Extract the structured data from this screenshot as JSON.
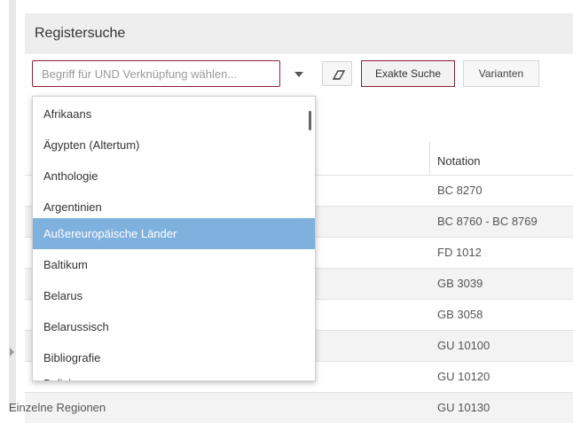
{
  "header": {
    "title": "Registersuche"
  },
  "toolbar": {
    "search_placeholder": "Begriff für UND Verknüpfung wählen...",
    "exact_button": "Exakte Suche",
    "variants_button": "Varianten"
  },
  "table": {
    "notation_header": "Notation",
    "rows": [
      {
        "label": "",
        "notation": "BC 8270"
      },
      {
        "label": "",
        "notation": "BC 8760 - BC 8769"
      },
      {
        "label": "",
        "notation": "FD 1012"
      },
      {
        "label": "",
        "notation": "GB 3039"
      },
      {
        "label": "",
        "notation": "GB 3058"
      },
      {
        "label": "",
        "notation": "GU 10100"
      },
      {
        "label": "",
        "notation": "GU 10120"
      },
      {
        "label": "Einzelne Regionen",
        "notation": "GU 10130"
      }
    ]
  },
  "dropdown": {
    "items": [
      "Afrikaans",
      "Ägypten (Altertum)",
      "Anthologie",
      "Argentinien",
      "Außereuropäische Länder",
      "Baltikum",
      "Belarus",
      "Belarussisch",
      "Bibliografie",
      "Bolivien"
    ],
    "selected_index": 4
  },
  "colors": {
    "accent_border": "#8b2332",
    "selected_item": "#7fb1df",
    "header_bg": "#eeeeee"
  }
}
